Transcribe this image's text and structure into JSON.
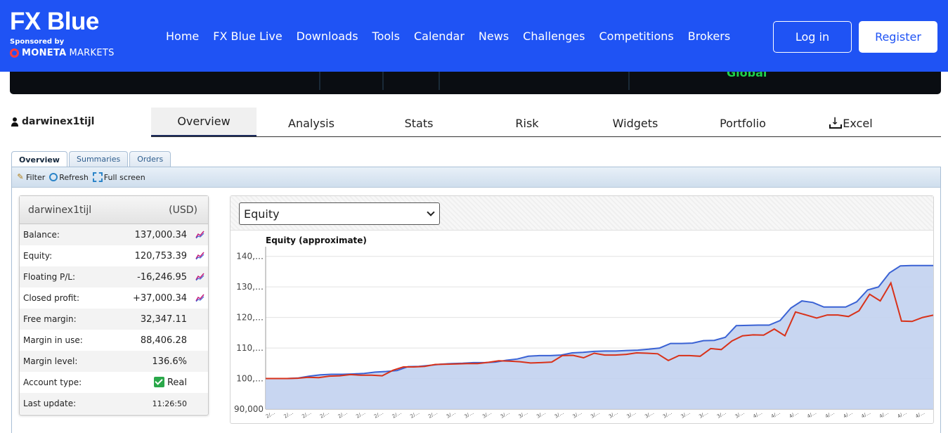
{
  "brand": {
    "logo": "FX Blue",
    "sponsored_by": "Sponsored by",
    "broker_bold": "MONETA",
    "broker_rest": "MARKETS"
  },
  "nav": [
    "Home",
    "FX Blue Live",
    "Downloads",
    "Tools",
    "Calendar",
    "News",
    "Challenges",
    "Competitions",
    "Brokers"
  ],
  "auth": {
    "login": "Log in",
    "register": "Register"
  },
  "banner": {
    "text": "Global"
  },
  "account": {
    "name": "darwinex1tijl",
    "tabs": [
      "Overview",
      "Analysis",
      "Stats",
      "Risk",
      "Widgets",
      "Portfolio",
      "Excel"
    ],
    "active_tab": "Overview"
  },
  "subtabs": [
    "Overview",
    "Summaries",
    "Orders"
  ],
  "toolbar": {
    "filter": "Filter",
    "refresh": "Refresh",
    "fullscreen": "Full screen"
  },
  "summary": {
    "name": "darwinex1tijl",
    "currency": "(USD)",
    "rows": [
      {
        "label": "Balance:",
        "value": "137,000.34",
        "chart": true
      },
      {
        "label": "Equity:",
        "value": "120,753.39",
        "chart": true
      },
      {
        "label": "Floating P/L:",
        "value": "-16,246.95",
        "chart": true
      },
      {
        "label": "Closed profit:",
        "value": "+37,000.34",
        "chart": true
      },
      {
        "label": "Free margin:",
        "value": "32,347.11",
        "chart": false
      },
      {
        "label": "Margin in use:",
        "value": "88,406.28",
        "chart": false
      },
      {
        "label": "Margin level:",
        "value": "136.6%",
        "chart": false
      },
      {
        "label": "Account type:",
        "value": "Real",
        "chart": false,
        "check": true
      },
      {
        "label": "Last update:",
        "value": "11:26:50",
        "chart": false,
        "small": true
      }
    ]
  },
  "chart_select": {
    "value": "Equity"
  },
  "chart_data": {
    "type": "area",
    "title": "Equity (approximate)",
    "ylim": [
      90000,
      142000
    ],
    "yticks": [
      90000,
      100000,
      110000,
      120000,
      130000,
      140000
    ],
    "ytick_labels": [
      "90,000",
      "100,…",
      "110,…",
      "120,…",
      "130,…",
      "140,…"
    ],
    "xtick_labels": [
      "2/…",
      "2/…",
      "2/…",
      "2/…",
      "2/…",
      "2/…",
      "2/…",
      "2/…",
      "2/…",
      "2/…",
      "3/…",
      "3/…",
      "3/…",
      "3/…",
      "3/…",
      "3/…",
      "3/…",
      "3/…",
      "3/…",
      "3/…",
      "3/…",
      "3/…",
      "3/…",
      "3/…",
      "3/…",
      "3/…",
      "3/…",
      "4/…",
      "4/…",
      "4/…",
      "4/…",
      "4/…",
      "4/…",
      "4/…",
      "4/…",
      "4/…",
      "4/…",
      "4/…"
    ],
    "grid": true,
    "colors": {
      "balance": "#3a62d4",
      "equity": "#d8321a",
      "fill": "#c2d1ef"
    },
    "series": [
      {
        "key": "balance",
        "values": [
          100000,
          100000,
          100000,
          100200,
          100800,
          101200,
          101400,
          101400,
          101500,
          101700,
          102100,
          102300,
          102600,
          103900,
          104000,
          104300,
          104700,
          104900,
          105000,
          105200,
          105200,
          105400,
          106000,
          106400,
          107300,
          107500,
          107500,
          107700,
          108400,
          108600,
          108900,
          109000,
          109000,
          109200,
          109300,
          109600,
          110000,
          111500,
          111500,
          111600,
          112400,
          112500,
          113500,
          117300,
          117400,
          117500,
          117500,
          119000,
          123100,
          125400,
          124900,
          123400,
          123400,
          123400,
          125100,
          129000,
          130000,
          134600,
          136900,
          137000,
          137000,
          137000
        ]
      },
      {
        "key": "equity",
        "values": [
          100000,
          100000,
          100000,
          100100,
          100400,
          100300,
          100800,
          100900,
          101300,
          101100,
          101100,
          100900,
          102700,
          103800,
          103800,
          104000,
          104600,
          104700,
          104800,
          104900,
          104900,
          105300,
          105800,
          105700,
          105500,
          105100,
          105200,
          105400,
          107500,
          107600,
          106800,
          108300,
          107700,
          107700,
          107900,
          108400,
          108300,
          108100,
          105900,
          107500,
          107500,
          107300,
          109800,
          109500,
          112300,
          114000,
          114300,
          114200,
          116200,
          114000,
          121800,
          120800,
          119800,
          120800,
          120800,
          120300,
          122200,
          127600,
          125400,
          131300,
          118800,
          118700,
          120000,
          120753
        ]
      }
    ]
  }
}
